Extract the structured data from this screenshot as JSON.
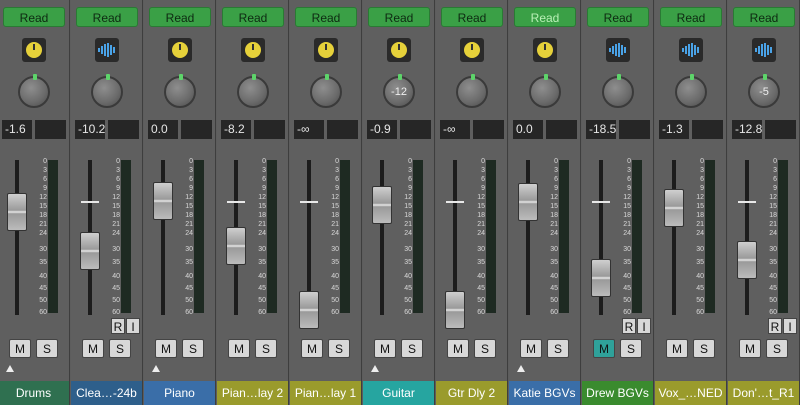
{
  "labels": {
    "read": "Read",
    "mute": "M",
    "solo": "S",
    "rec": "R",
    "input": "I"
  },
  "scale": [
    "0",
    "3",
    "6",
    "9",
    "12",
    "15",
    "18",
    "21",
    "24",
    "30",
    "35",
    "40",
    "45",
    "50",
    "60"
  ],
  "channels": [
    {
      "name": "Drums",
      "volume": "-1.6",
      "plugin": "knob",
      "fader_db": "-1.6",
      "pan": "",
      "read_alt": false,
      "name_color": "#2f7050",
      "ri": false,
      "mute_on": false,
      "triangle": true
    },
    {
      "name": "Clea…-24b",
      "volume": "-10.2",
      "plugin": "wave",
      "fader_db": "-10.2",
      "pan": "",
      "read_alt": false,
      "name_color": "#2e5f8b",
      "ri": true,
      "mute_on": false,
      "triangle": false
    },
    {
      "name": "Piano",
      "volume": "0.0",
      "plugin": "knob",
      "fader_db": "0.0",
      "pan": "",
      "read_alt": false,
      "name_color": "#3a6ea8",
      "ri": false,
      "mute_on": false,
      "triangle": true
    },
    {
      "name": "Pian…lay 2",
      "volume": "-8.2",
      "plugin": "knob",
      "fader_db": "-8.2",
      "pan": "",
      "read_alt": false,
      "name_color": "#9a9b2c",
      "ri": false,
      "mute_on": false,
      "triangle": false
    },
    {
      "name": "Pian…lay 1",
      "volume": "-∞",
      "plugin": "knob",
      "fader_db": "-∞",
      "pan": "",
      "read_alt": false,
      "name_color": "#9a9b2c",
      "ri": false,
      "mute_on": false,
      "triangle": false
    },
    {
      "name": "Guitar",
      "volume": "-0.9",
      "plugin": "knob",
      "fader_db": "-0.9",
      "pan": "-12",
      "read_alt": false,
      "name_color": "#26a5a0",
      "ri": false,
      "mute_on": false,
      "triangle": true
    },
    {
      "name": "Gtr Dly 2",
      "volume": "-∞",
      "plugin": "knob",
      "fader_db": "-∞",
      "pan": "",
      "read_alt": false,
      "name_color": "#9a9b2c",
      "ri": false,
      "mute_on": false,
      "triangle": false
    },
    {
      "name": "Katie BGVs",
      "volume": "0.0",
      "plugin": "knob",
      "fader_db": "0.0",
      "pan": "",
      "read_alt": true,
      "name_color": "#3a6ea8",
      "ri": false,
      "mute_on": false,
      "triangle": true
    },
    {
      "name": "Drew BGVs",
      "volume": "-18.5",
      "plugin": "wave",
      "fader_db": "-18.5",
      "pan": "",
      "read_alt": false,
      "name_color": "#3a8b2e",
      "ri": true,
      "mute_on": true,
      "triangle": false
    },
    {
      "name": "Vox_…NED",
      "volume": "-1.3",
      "plugin": "wave",
      "fader_db": "-1.3",
      "pan": "",
      "read_alt": false,
      "name_color": "#9a9b2c",
      "ri": false,
      "mute_on": false,
      "triangle": false
    },
    {
      "name": "Don'…t_R1",
      "volume": "-12.8",
      "plugin": "wave",
      "fader_db": "-12.8",
      "pan": "-5",
      "read_alt": false,
      "name_color": "#9a9b2c",
      "ri": true,
      "mute_on": false,
      "triangle": false
    }
  ]
}
